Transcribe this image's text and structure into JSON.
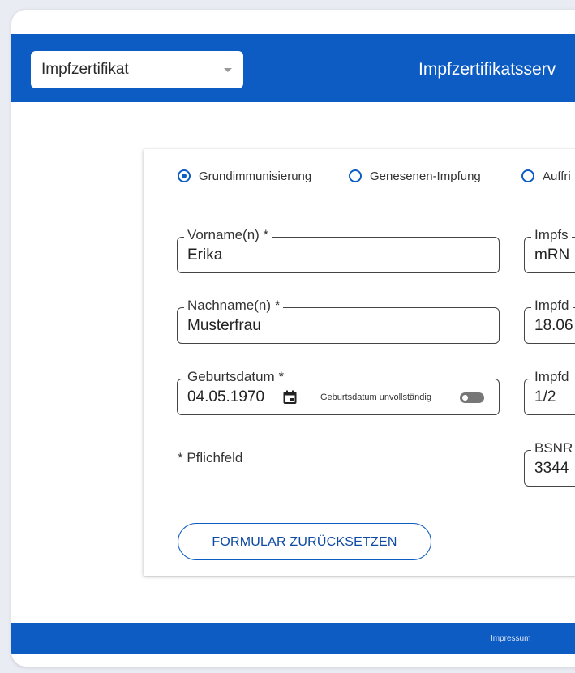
{
  "header": {
    "certificate_select": {
      "selected": "Impfzertifikat"
    },
    "title": "Impfzertifikatsserv"
  },
  "vaccination_type": {
    "options": [
      {
        "label": "Grundimmunisierung",
        "checked": true
      },
      {
        "label": "Genesenen-Impfung",
        "checked": false
      },
      {
        "label": "Auffri",
        "checked": false
      }
    ]
  },
  "form": {
    "vorname": {
      "label": "Vorname(n) *",
      "value": "Erika"
    },
    "nachname": {
      "label": "Nachname(n) *",
      "value": "Musterfrau"
    },
    "geburtsdatum": {
      "label": "Geburtsdatum *",
      "value": "04.05.1970",
      "incomplete_toggle_label": "Geburtsdatum unvollständig",
      "incomplete_toggle_on": false
    },
    "impfstoff": {
      "label": "Impfs",
      "value": "mRN"
    },
    "impfdatum": {
      "label": "Impfd",
      "value": "18.06"
    },
    "impfdosis": {
      "label": "Impfd",
      "value": "1/2"
    },
    "bsnr": {
      "label": "BSNR",
      "value": "3344"
    },
    "required_note": "* Pflichfeld",
    "reset_button": "FORMULAR ZURÜCKSETZEN"
  },
  "footer": {
    "impressum": "Impressum"
  },
  "colors": {
    "brand": "#0d5cc4",
    "text": "#333333",
    "background": "#ffffff"
  }
}
